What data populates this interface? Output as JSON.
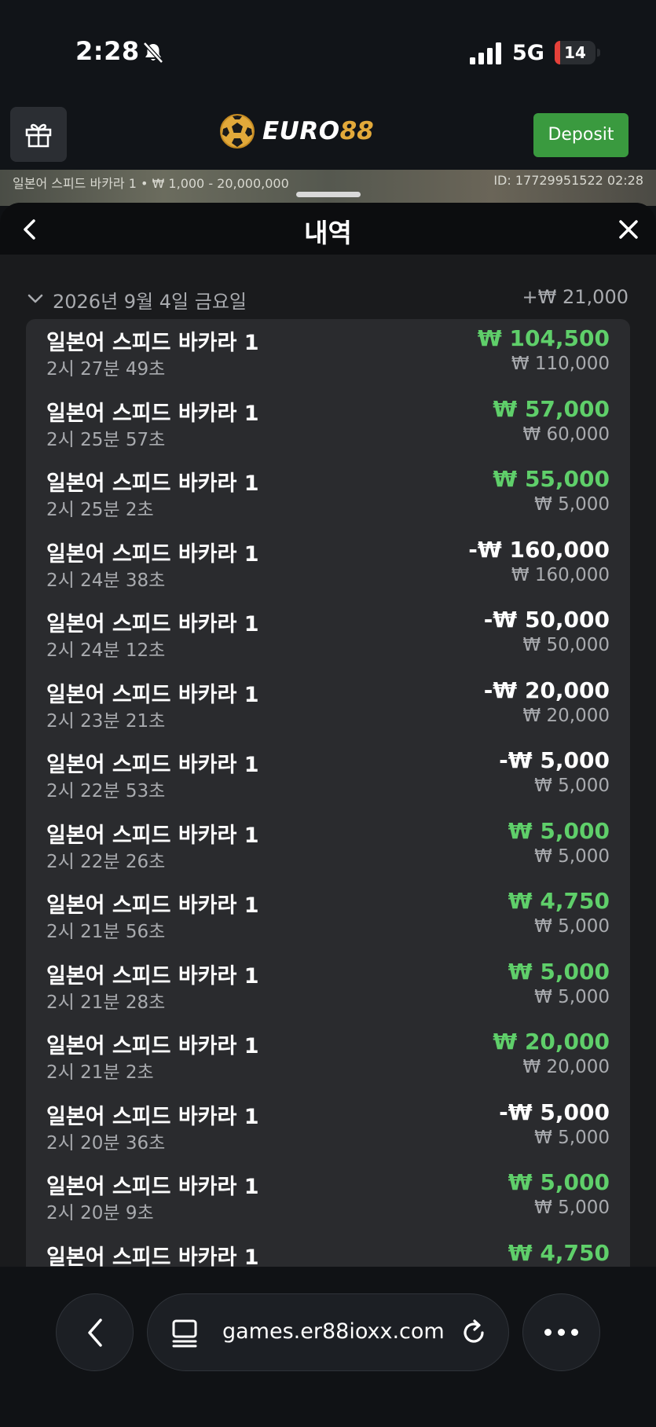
{
  "status_bar": {
    "time": "2:28",
    "network": "5G",
    "battery": "14",
    "battery_level": 0.14
  },
  "header": {
    "logo_a": "EURO",
    "logo_b": "88",
    "deposit_label": "Deposit"
  },
  "game_strip": {
    "info": "일본어 스피드 바카라 1 • ₩ 1,000 - 20,000,000",
    "id": "ID: 17729951522 02:28"
  },
  "sheet": {
    "title": "내역",
    "date_label": "2026년 9월 4일 금요일",
    "date_total": "+₩ 21,000",
    "items": [
      {
        "title": "일본어 스피드 바카라 1",
        "time": "2시 27분 49초",
        "amount": "₩ 104,500",
        "bet": "₩ 110,000",
        "result": "win"
      },
      {
        "title": "일본어 스피드 바카라 1",
        "time": "2시 25분 57초",
        "amount": "₩ 57,000",
        "bet": "₩ 60,000",
        "result": "win"
      },
      {
        "title": "일본어 스피드 바카라 1",
        "time": "2시 25분 2초",
        "amount": "₩ 55,000",
        "bet": "₩ 5,000",
        "result": "win"
      },
      {
        "title": "일본어 스피드 바카라 1",
        "time": "2시 24분 38초",
        "amount": "-₩ 160,000",
        "bet": "₩ 160,000",
        "result": "loss"
      },
      {
        "title": "일본어 스피드 바카라 1",
        "time": "2시 24분 12초",
        "amount": "-₩ 50,000",
        "bet": "₩ 50,000",
        "result": "loss"
      },
      {
        "title": "일본어 스피드 바카라 1",
        "time": "2시 23분 21초",
        "amount": "-₩ 20,000",
        "bet": "₩ 20,000",
        "result": "loss"
      },
      {
        "title": "일본어 스피드 바카라 1",
        "time": "2시 22분 53초",
        "amount": "-₩ 5,000",
        "bet": "₩ 5,000",
        "result": "loss"
      },
      {
        "title": "일본어 스피드 바카라 1",
        "time": "2시 22분 26초",
        "amount": "₩ 5,000",
        "bet": "₩ 5,000",
        "result": "win"
      },
      {
        "title": "일본어 스피드 바카라 1",
        "time": "2시 21분 56초",
        "amount": "₩ 4,750",
        "bet": "₩ 5,000",
        "result": "win"
      },
      {
        "title": "일본어 스피드 바카라 1",
        "time": "2시 21분 28초",
        "amount": "₩ 5,000",
        "bet": "₩ 5,000",
        "result": "win"
      },
      {
        "title": "일본어 스피드 바카라 1",
        "time": "2시 21분 2초",
        "amount": "₩ 20,000",
        "bet": "₩ 20,000",
        "result": "win"
      },
      {
        "title": "일본어 스피드 바카라 1",
        "time": "2시 20분 36초",
        "amount": "-₩ 5,000",
        "bet": "₩ 5,000",
        "result": "loss"
      },
      {
        "title": "일본어 스피드 바카라 1",
        "time": "2시 20분 9초",
        "amount": "₩ 5,000",
        "bet": "₩ 5,000",
        "result": "win"
      },
      {
        "title": "일본어 스피드 바카라 1",
        "time": "",
        "amount": "₩ 4,750",
        "bet": "",
        "result": "win"
      }
    ]
  },
  "browser": {
    "url": "games.er88ioxx.com"
  },
  "colors": {
    "win": "#5fcf6a",
    "deposit": "#3a9a3f",
    "logo_accent": "#e2a93a",
    "battery_low": "#e5413a"
  },
  "icons": [
    "bell-off-icon",
    "signal-icon",
    "gift-icon",
    "soccer-ball-icon",
    "chevron-left-icon",
    "close-icon",
    "chevron-down-icon",
    "tabs-icon",
    "reload-icon",
    "more-icon"
  ]
}
